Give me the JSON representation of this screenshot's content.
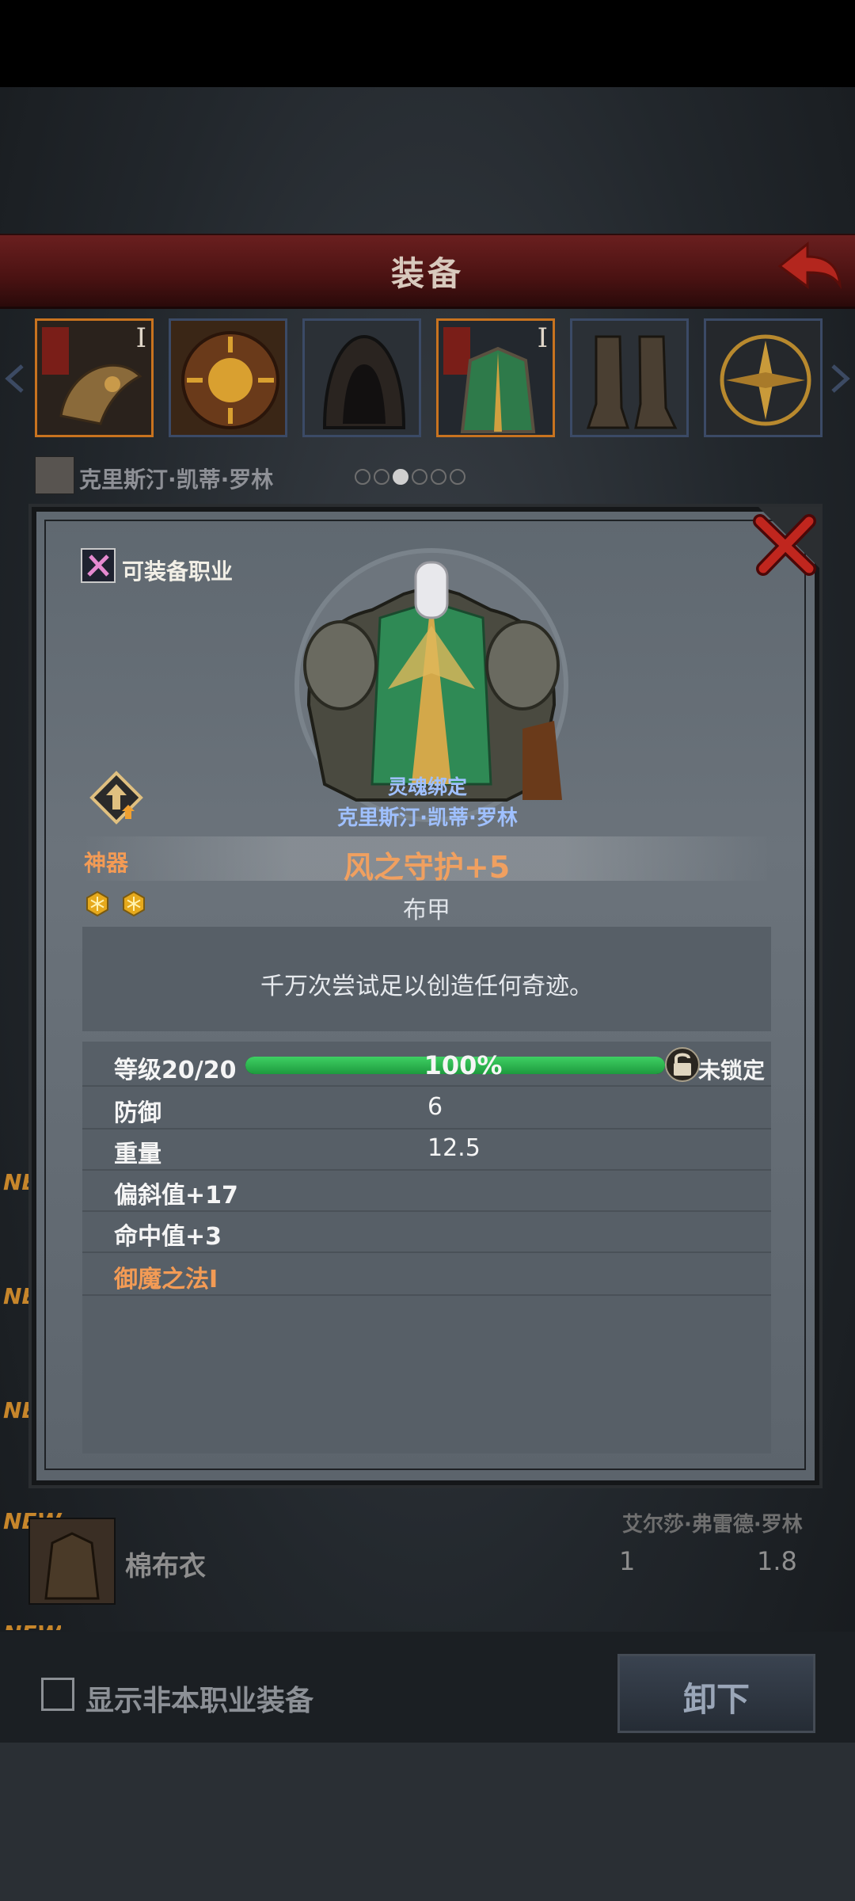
{
  "screen": {
    "title": "装备",
    "owner_name": "克里斯汀·凯蒂·罗林",
    "page_dots": [
      false,
      false,
      true,
      false,
      false,
      false
    ],
    "equipment_slots": [
      {
        "icon": "dragon-amulet-icon",
        "roman": "I",
        "selected": false
      },
      {
        "icon": "sun-shield-icon",
        "roman": "",
        "selected": false
      },
      {
        "icon": "hood-icon",
        "roman": "",
        "selected": false
      },
      {
        "icon": "armor-icon",
        "roman": "I",
        "selected": true
      },
      {
        "icon": "boots-icon",
        "roman": "",
        "selected": false
      },
      {
        "icon": "compass-icon",
        "roman": "",
        "selected": false
      }
    ],
    "list": {
      "new_labels": [
        "NEW",
        "NEW",
        "NEW",
        "NEW",
        "NEW"
      ],
      "visible_item": {
        "name": "棉布衣",
        "owner": "艾尔莎·弗雷德·罗林",
        "defense": "1",
        "weight": "1.8"
      }
    },
    "show_non_class_label": "显示非本职业装备",
    "unequip_label": "卸下"
  },
  "modal": {
    "class_label": "可装备职业",
    "soulbind_label": "灵魂绑定",
    "soulbind_owner": "克里斯汀·凯蒂·罗林",
    "rarity": "神器",
    "stars": 2,
    "item_name": "风之守护+5",
    "item_type": "布甲",
    "description": "千万次尝试足以创造任何奇迹。",
    "level_label": "等级20/20",
    "progress_percent": 100,
    "progress_text": "100%",
    "lock_label": "未锁定",
    "stats": [
      {
        "label": "防御",
        "value": "6"
      },
      {
        "label": "重量",
        "value": "12.5"
      },
      {
        "label": "偏斜值+17",
        "value": ""
      },
      {
        "label": "命中值+3",
        "value": ""
      },
      {
        "label": "御魔之法I",
        "value": "",
        "highlight": true
      }
    ]
  }
}
